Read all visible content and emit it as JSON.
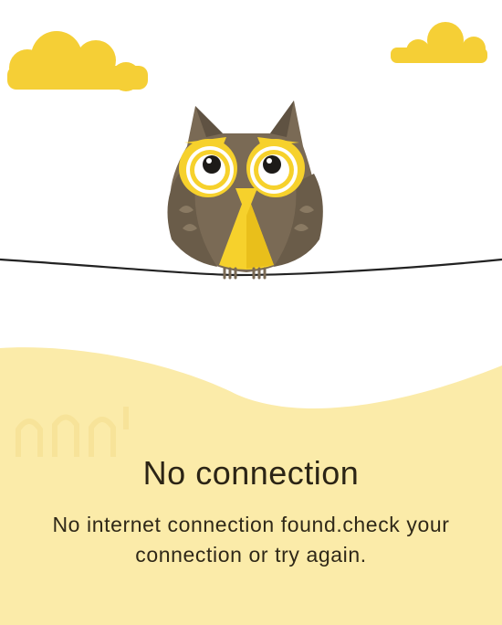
{
  "error_screen": {
    "title": "No connection",
    "message": "No internet connection found.check your connection or try again."
  },
  "colors": {
    "background": "#ffffff",
    "cloud": "#f5cf36",
    "hill": "#fbeba9",
    "owl_body": "#7a6a55",
    "owl_accent": "#f6d12c",
    "text": "#2b2415"
  },
  "icons": {
    "illustration": "owl-on-wire-illustration",
    "clouds": "cloud-icon"
  }
}
